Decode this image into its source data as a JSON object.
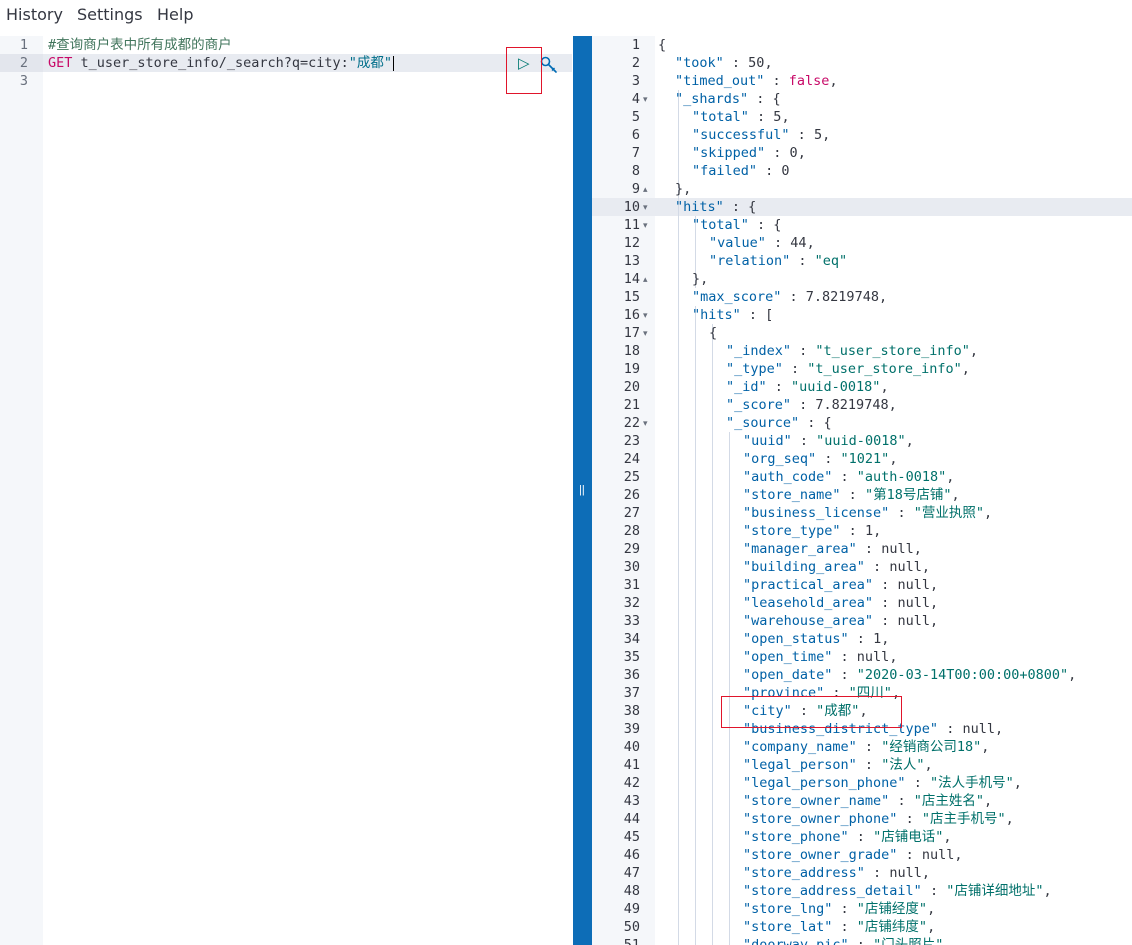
{
  "menu": {
    "history": "History",
    "settings": "Settings",
    "help": "Help"
  },
  "request": {
    "comment": "#查询商户表中所有成都的商户",
    "method": "GET",
    "path": "t_user_store_info/_search?q=city:",
    "value": "\"成都\""
  },
  "colors": {
    "accent": "#0d6db7",
    "highlight": "#e0152b"
  },
  "response_lines": [
    [
      [
        "p",
        "{"
      ]
    ],
    [
      [
        "k",
        "\"took\""
      ],
      [
        "p",
        " : "
      ],
      [
        "n",
        "50"
      ],
      [
        "p",
        ","
      ]
    ],
    [
      [
        "k",
        "\"timed_out\""
      ],
      [
        "p",
        " : "
      ],
      [
        "b",
        "false"
      ],
      [
        "p",
        ","
      ]
    ],
    [
      [
        "k",
        "\"_shards\""
      ],
      [
        "p",
        " : {"
      ]
    ],
    [
      [
        "k",
        "\"total\""
      ],
      [
        "p",
        " : "
      ],
      [
        "n",
        "5"
      ],
      [
        "p",
        ","
      ]
    ],
    [
      [
        "k",
        "\"successful\""
      ],
      [
        "p",
        " : "
      ],
      [
        "n",
        "5"
      ],
      [
        "p",
        ","
      ]
    ],
    [
      [
        "k",
        "\"skipped\""
      ],
      [
        "p",
        " : "
      ],
      [
        "n",
        "0"
      ],
      [
        "p",
        ","
      ]
    ],
    [
      [
        "k",
        "\"failed\""
      ],
      [
        "p",
        " : "
      ],
      [
        "n",
        "0"
      ]
    ],
    [
      [
        "p",
        "},"
      ]
    ],
    [
      [
        "k",
        "\"hits\""
      ],
      [
        "p",
        " : {"
      ]
    ],
    [
      [
        "k",
        "\"total\""
      ],
      [
        "p",
        " : {"
      ]
    ],
    [
      [
        "k",
        "\"value\""
      ],
      [
        "p",
        " : "
      ],
      [
        "n",
        "44"
      ],
      [
        "p",
        ","
      ]
    ],
    [
      [
        "k",
        "\"relation\""
      ],
      [
        "p",
        " : "
      ],
      [
        "s",
        "\"eq\""
      ]
    ],
    [
      [
        "p",
        "},"
      ]
    ],
    [
      [
        "k",
        "\"max_score\""
      ],
      [
        "p",
        " : "
      ],
      [
        "n",
        "7.8219748"
      ],
      [
        "p",
        ","
      ]
    ],
    [
      [
        "k",
        "\"hits\""
      ],
      [
        "p",
        " : ["
      ]
    ],
    [
      [
        "p",
        "{"
      ]
    ],
    [
      [
        "k",
        "\"_index\""
      ],
      [
        "p",
        " : "
      ],
      [
        "s",
        "\"t_user_store_info\""
      ],
      [
        "p",
        ","
      ]
    ],
    [
      [
        "k",
        "\"_type\""
      ],
      [
        "p",
        " : "
      ],
      [
        "s",
        "\"t_user_store_info\""
      ],
      [
        "p",
        ","
      ]
    ],
    [
      [
        "k",
        "\"_id\""
      ],
      [
        "p",
        " : "
      ],
      [
        "s",
        "\"uuid-0018\""
      ],
      [
        "p",
        ","
      ]
    ],
    [
      [
        "k",
        "\"_score\""
      ],
      [
        "p",
        " : "
      ],
      [
        "n",
        "7.8219748"
      ],
      [
        "p",
        ","
      ]
    ],
    [
      [
        "k",
        "\"_source\""
      ],
      [
        "p",
        " : {"
      ]
    ],
    [
      [
        "k",
        "\"uuid\""
      ],
      [
        "p",
        " : "
      ],
      [
        "s",
        "\"uuid-0018\""
      ],
      [
        "p",
        ","
      ]
    ],
    [
      [
        "k",
        "\"org_seq\""
      ],
      [
        "p",
        " : "
      ],
      [
        "s",
        "\"1021\""
      ],
      [
        "p",
        ","
      ]
    ],
    [
      [
        "k",
        "\"auth_code\""
      ],
      [
        "p",
        " : "
      ],
      [
        "s",
        "\"auth-0018\""
      ],
      [
        "p",
        ","
      ]
    ],
    [
      [
        "k",
        "\"store_name\""
      ],
      [
        "p",
        " : "
      ],
      [
        "s",
        "\"第18号店铺\""
      ],
      [
        "p",
        ","
      ]
    ],
    [
      [
        "k",
        "\"business_license\""
      ],
      [
        "p",
        " : "
      ],
      [
        "s",
        "\"营业执照\""
      ],
      [
        "p",
        ","
      ]
    ],
    [
      [
        "k",
        "\"store_type\""
      ],
      [
        "p",
        " : "
      ],
      [
        "n",
        "1"
      ],
      [
        "p",
        ","
      ]
    ],
    [
      [
        "k",
        "\"manager_area\""
      ],
      [
        "p",
        " : "
      ],
      [
        "n",
        "null"
      ],
      [
        "p",
        ","
      ]
    ],
    [
      [
        "k",
        "\"building_area\""
      ],
      [
        "p",
        " : "
      ],
      [
        "n",
        "null"
      ],
      [
        "p",
        ","
      ]
    ],
    [
      [
        "k",
        "\"practical_area\""
      ],
      [
        "p",
        " : "
      ],
      [
        "n",
        "null"
      ],
      [
        "p",
        ","
      ]
    ],
    [
      [
        "k",
        "\"leasehold_area\""
      ],
      [
        "p",
        " : "
      ],
      [
        "n",
        "null"
      ],
      [
        "p",
        ","
      ]
    ],
    [
      [
        "k",
        "\"warehouse_area\""
      ],
      [
        "p",
        " : "
      ],
      [
        "n",
        "null"
      ],
      [
        "p",
        ","
      ]
    ],
    [
      [
        "k",
        "\"open_status\""
      ],
      [
        "p",
        " : "
      ],
      [
        "n",
        "1"
      ],
      [
        "p",
        ","
      ]
    ],
    [
      [
        "k",
        "\"open_time\""
      ],
      [
        "p",
        " : "
      ],
      [
        "n",
        "null"
      ],
      [
        "p",
        ","
      ]
    ],
    [
      [
        "k",
        "\"open_date\""
      ],
      [
        "p",
        " : "
      ],
      [
        "s",
        "\"2020-03-14T00:00:00+0800\""
      ],
      [
        "p",
        ","
      ]
    ],
    [
      [
        "k",
        "\"province\""
      ],
      [
        "p",
        " : "
      ],
      [
        "s",
        "\"四川\""
      ],
      [
        "p",
        ","
      ]
    ],
    [
      [
        "k",
        "\"city\""
      ],
      [
        "p",
        " : "
      ],
      [
        "s",
        "\"成都\""
      ],
      [
        "p",
        ","
      ]
    ],
    [
      [
        "k",
        "\"business_district_type\""
      ],
      [
        "p",
        " : "
      ],
      [
        "n",
        "null"
      ],
      [
        "p",
        ","
      ]
    ],
    [
      [
        "k",
        "\"company_name\""
      ],
      [
        "p",
        " : "
      ],
      [
        "s",
        "\"经销商公司18\""
      ],
      [
        "p",
        ","
      ]
    ],
    [
      [
        "k",
        "\"legal_person\""
      ],
      [
        "p",
        " : "
      ],
      [
        "s",
        "\"法人\""
      ],
      [
        "p",
        ","
      ]
    ],
    [
      [
        "k",
        "\"legal_person_phone\""
      ],
      [
        "p",
        " : "
      ],
      [
        "s",
        "\"法人手机号\""
      ],
      [
        "p",
        ","
      ]
    ],
    [
      [
        "k",
        "\"store_owner_name\""
      ],
      [
        "p",
        " : "
      ],
      [
        "s",
        "\"店主姓名\""
      ],
      [
        "p",
        ","
      ]
    ],
    [
      [
        "k",
        "\"store_owner_phone\""
      ],
      [
        "p",
        " : "
      ],
      [
        "s",
        "\"店主手机号\""
      ],
      [
        "p",
        ","
      ]
    ],
    [
      [
        "k",
        "\"store_phone\""
      ],
      [
        "p",
        " : "
      ],
      [
        "s",
        "\"店铺电话\""
      ],
      [
        "p",
        ","
      ]
    ],
    [
      [
        "k",
        "\"store_owner_grade\""
      ],
      [
        "p",
        " : "
      ],
      [
        "n",
        "null"
      ],
      [
        "p",
        ","
      ]
    ],
    [
      [
        "k",
        "\"store_address\""
      ],
      [
        "p",
        " : "
      ],
      [
        "n",
        "null"
      ],
      [
        "p",
        ","
      ]
    ],
    [
      [
        "k",
        "\"store_address_detail\""
      ],
      [
        "p",
        " : "
      ],
      [
        "s",
        "\"店铺详细地址\""
      ],
      [
        "p",
        ","
      ]
    ],
    [
      [
        "k",
        "\"store_lng\""
      ],
      [
        "p",
        " : "
      ],
      [
        "s",
        "\"店铺经度\""
      ],
      [
        "p",
        ","
      ]
    ],
    [
      [
        "k",
        "\"store_lat\""
      ],
      [
        "p",
        " : "
      ],
      [
        "s",
        "\"店铺纬度\""
      ],
      [
        "p",
        ","
      ]
    ],
    [
      [
        "k",
        "\"doorway_pic\""
      ],
      [
        "p",
        " : "
      ],
      [
        "s",
        "\"门头照片\""
      ],
      [
        "p",
        ","
      ]
    ]
  ]
}
